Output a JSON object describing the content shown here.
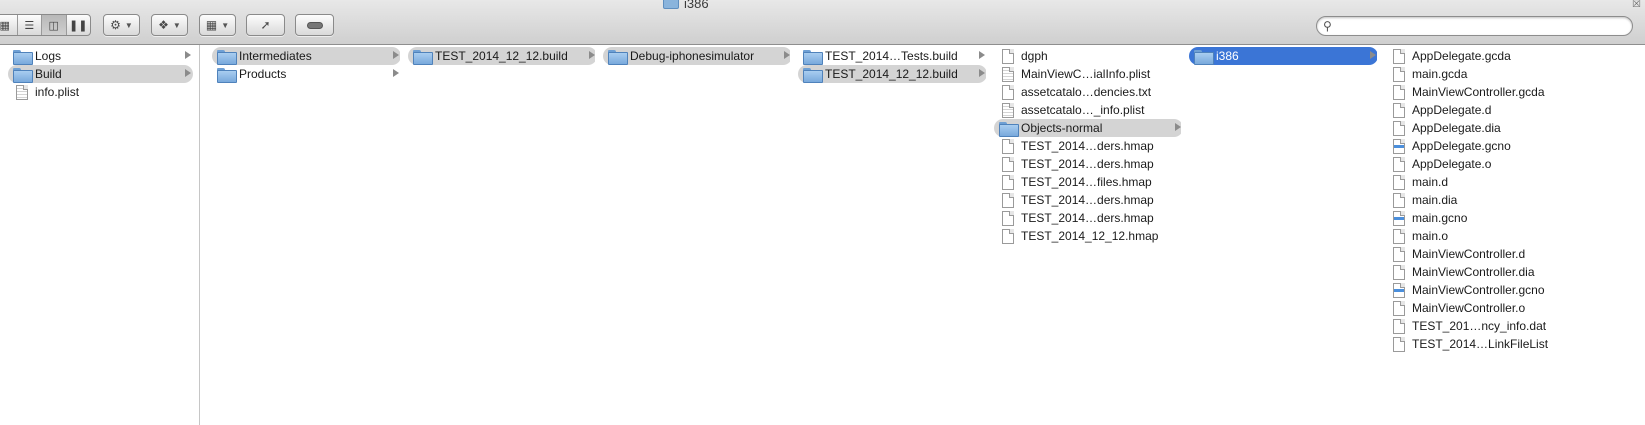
{
  "window": {
    "title": "i386"
  },
  "toolbar": {
    "view_modes": [
      "icon-view",
      "list-view",
      "column-view",
      "coverflow-view"
    ],
    "active_view": "column-view",
    "action_icon": "gear-icon",
    "dropbox_icon": "dropbox-icon",
    "arrange_icon": "arrange-icon",
    "share_icon": "share-icon",
    "tags_icon": "tag-icon",
    "search_placeholder": ""
  },
  "colors": {
    "selection_blue": "#3b75d6",
    "selection_gray": "#d4d4d4",
    "folder": "#79a9dc"
  },
  "columns": [
    {
      "items": [
        {
          "label": "Logs",
          "type": "folder",
          "arrow": true
        },
        {
          "label": "Build",
          "type": "folder",
          "arrow": true,
          "state": "path"
        },
        {
          "label": "info.plist",
          "type": "lined"
        }
      ]
    },
    {
      "items": [
        {
          "label": "Intermediates",
          "type": "folder",
          "arrow": true,
          "state": "path"
        },
        {
          "label": "Products",
          "type": "folder",
          "arrow": true
        }
      ]
    },
    {
      "items": [
        {
          "label": "TEST_2014_12_12.build",
          "type": "folder",
          "arrow": true,
          "state": "path"
        }
      ]
    },
    {
      "items": [
        {
          "label": "Debug-iphonesimulator",
          "type": "folder",
          "arrow": true,
          "state": "path"
        }
      ]
    },
    {
      "items": [
        {
          "label": "TEST_2014…Tests.build",
          "type": "folder",
          "arrow": true
        },
        {
          "label": "TEST_2014_12_12.build",
          "type": "folder",
          "arrow": true,
          "state": "path"
        }
      ]
    },
    {
      "items": [
        {
          "label": "dgph",
          "type": "doc"
        },
        {
          "label": "MainViewC…ialInfo.plist",
          "type": "lined"
        },
        {
          "label": "assetcatalo…dencies.txt",
          "type": "doc"
        },
        {
          "label": "assetcatalo…_info.plist",
          "type": "lined"
        },
        {
          "label": "Objects-normal",
          "type": "folder",
          "arrow": true,
          "state": "path"
        },
        {
          "label": "TEST_2014…ders.hmap",
          "type": "doc"
        },
        {
          "label": "TEST_2014…ders.hmap",
          "type": "doc"
        },
        {
          "label": "TEST_2014…files.hmap",
          "type": "doc"
        },
        {
          "label": "TEST_2014…ders.hmap",
          "type": "doc"
        },
        {
          "label": "TEST_2014…ders.hmap",
          "type": "doc"
        },
        {
          "label": "TEST_2014_12_12.hmap",
          "type": "doc"
        }
      ]
    },
    {
      "items": [
        {
          "label": "i386",
          "type": "folder",
          "arrow": true,
          "state": "selected"
        }
      ]
    },
    {
      "items": [
        {
          "label": "AppDelegate.gcda",
          "type": "doc"
        },
        {
          "label": "main.gcda",
          "type": "doc"
        },
        {
          "label": "MainViewController.gcda",
          "type": "doc"
        },
        {
          "label": "AppDelegate.d",
          "type": "doc"
        },
        {
          "label": "AppDelegate.dia",
          "type": "doc"
        },
        {
          "label": "AppDelegate.gcno",
          "type": "gcno"
        },
        {
          "label": "AppDelegate.o",
          "type": "doc"
        },
        {
          "label": "main.d",
          "type": "doc"
        },
        {
          "label": "main.dia",
          "type": "doc"
        },
        {
          "label": "main.gcno",
          "type": "gcno"
        },
        {
          "label": "main.o",
          "type": "doc"
        },
        {
          "label": "MainViewController.d",
          "type": "doc"
        },
        {
          "label": "MainViewController.dia",
          "type": "doc"
        },
        {
          "label": "MainViewController.gcno",
          "type": "gcno"
        },
        {
          "label": "MainViewController.o",
          "type": "doc"
        },
        {
          "label": "TEST_201…ncy_info.dat",
          "type": "doc"
        },
        {
          "label": "TEST_2014…LinkFileList",
          "type": "doc"
        }
      ]
    }
  ]
}
